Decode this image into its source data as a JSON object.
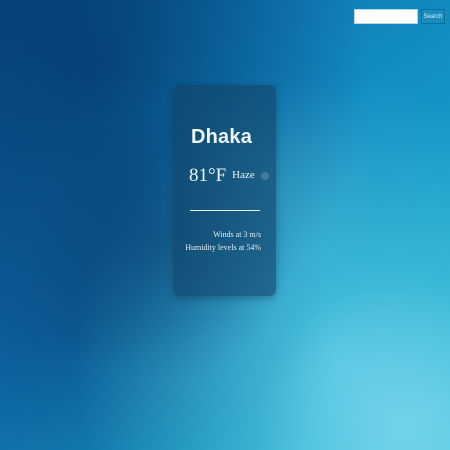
{
  "search": {
    "placeholder": "",
    "value": "",
    "button_label": "Search"
  },
  "weather": {
    "city": "Dhaka",
    "temperature": "81°F",
    "condition": "Haze",
    "wind": "Winds at 3 m/s",
    "humidity": "Humidity levels at 54%"
  },
  "icons": {
    "condition_icon": "haze-icon"
  }
}
